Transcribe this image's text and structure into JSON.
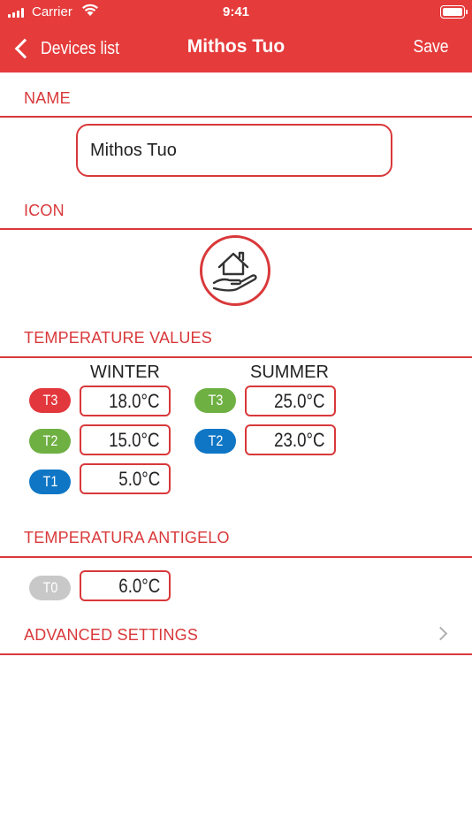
{
  "status_bar": {
    "carrier": "Carrier",
    "time": "9:41"
  },
  "nav": {
    "back_label": "Devices list",
    "title": "Mithos Tuo",
    "save_label": "Save"
  },
  "sections": {
    "name": "NAME",
    "icon": "ICON",
    "temperature_values": "TEMPERATURE VALUES",
    "antigelo": "TEMPERATURA ANTIGELO",
    "advanced": "ADVANCED SETTINGS"
  },
  "name_field": {
    "value": "Mithos Tuo"
  },
  "icon_name": "home-hand-icon",
  "temperatures": {
    "winter_label": "WINTER",
    "summer_label": "SUMMER",
    "winter": [
      {
        "tag": "T3",
        "color": "#e2373c",
        "value": "18.0°C"
      },
      {
        "tag": "T2",
        "color": "#6fb043",
        "value": "15.0°C"
      },
      {
        "tag": "T1",
        "color": "#0f76c5",
        "value": "5.0°C"
      }
    ],
    "summer": [
      {
        "tag": "T3",
        "color": "#6fb043",
        "value": "25.0°C"
      },
      {
        "tag": "T2",
        "color": "#0f76c5",
        "value": "23.0°C"
      }
    ]
  },
  "antigelo": {
    "tag": "T0",
    "color": "#c8c8c8",
    "value": "6.0°C"
  },
  "colors": {
    "accent": "#e53b3b",
    "divider": "#d9383a"
  }
}
